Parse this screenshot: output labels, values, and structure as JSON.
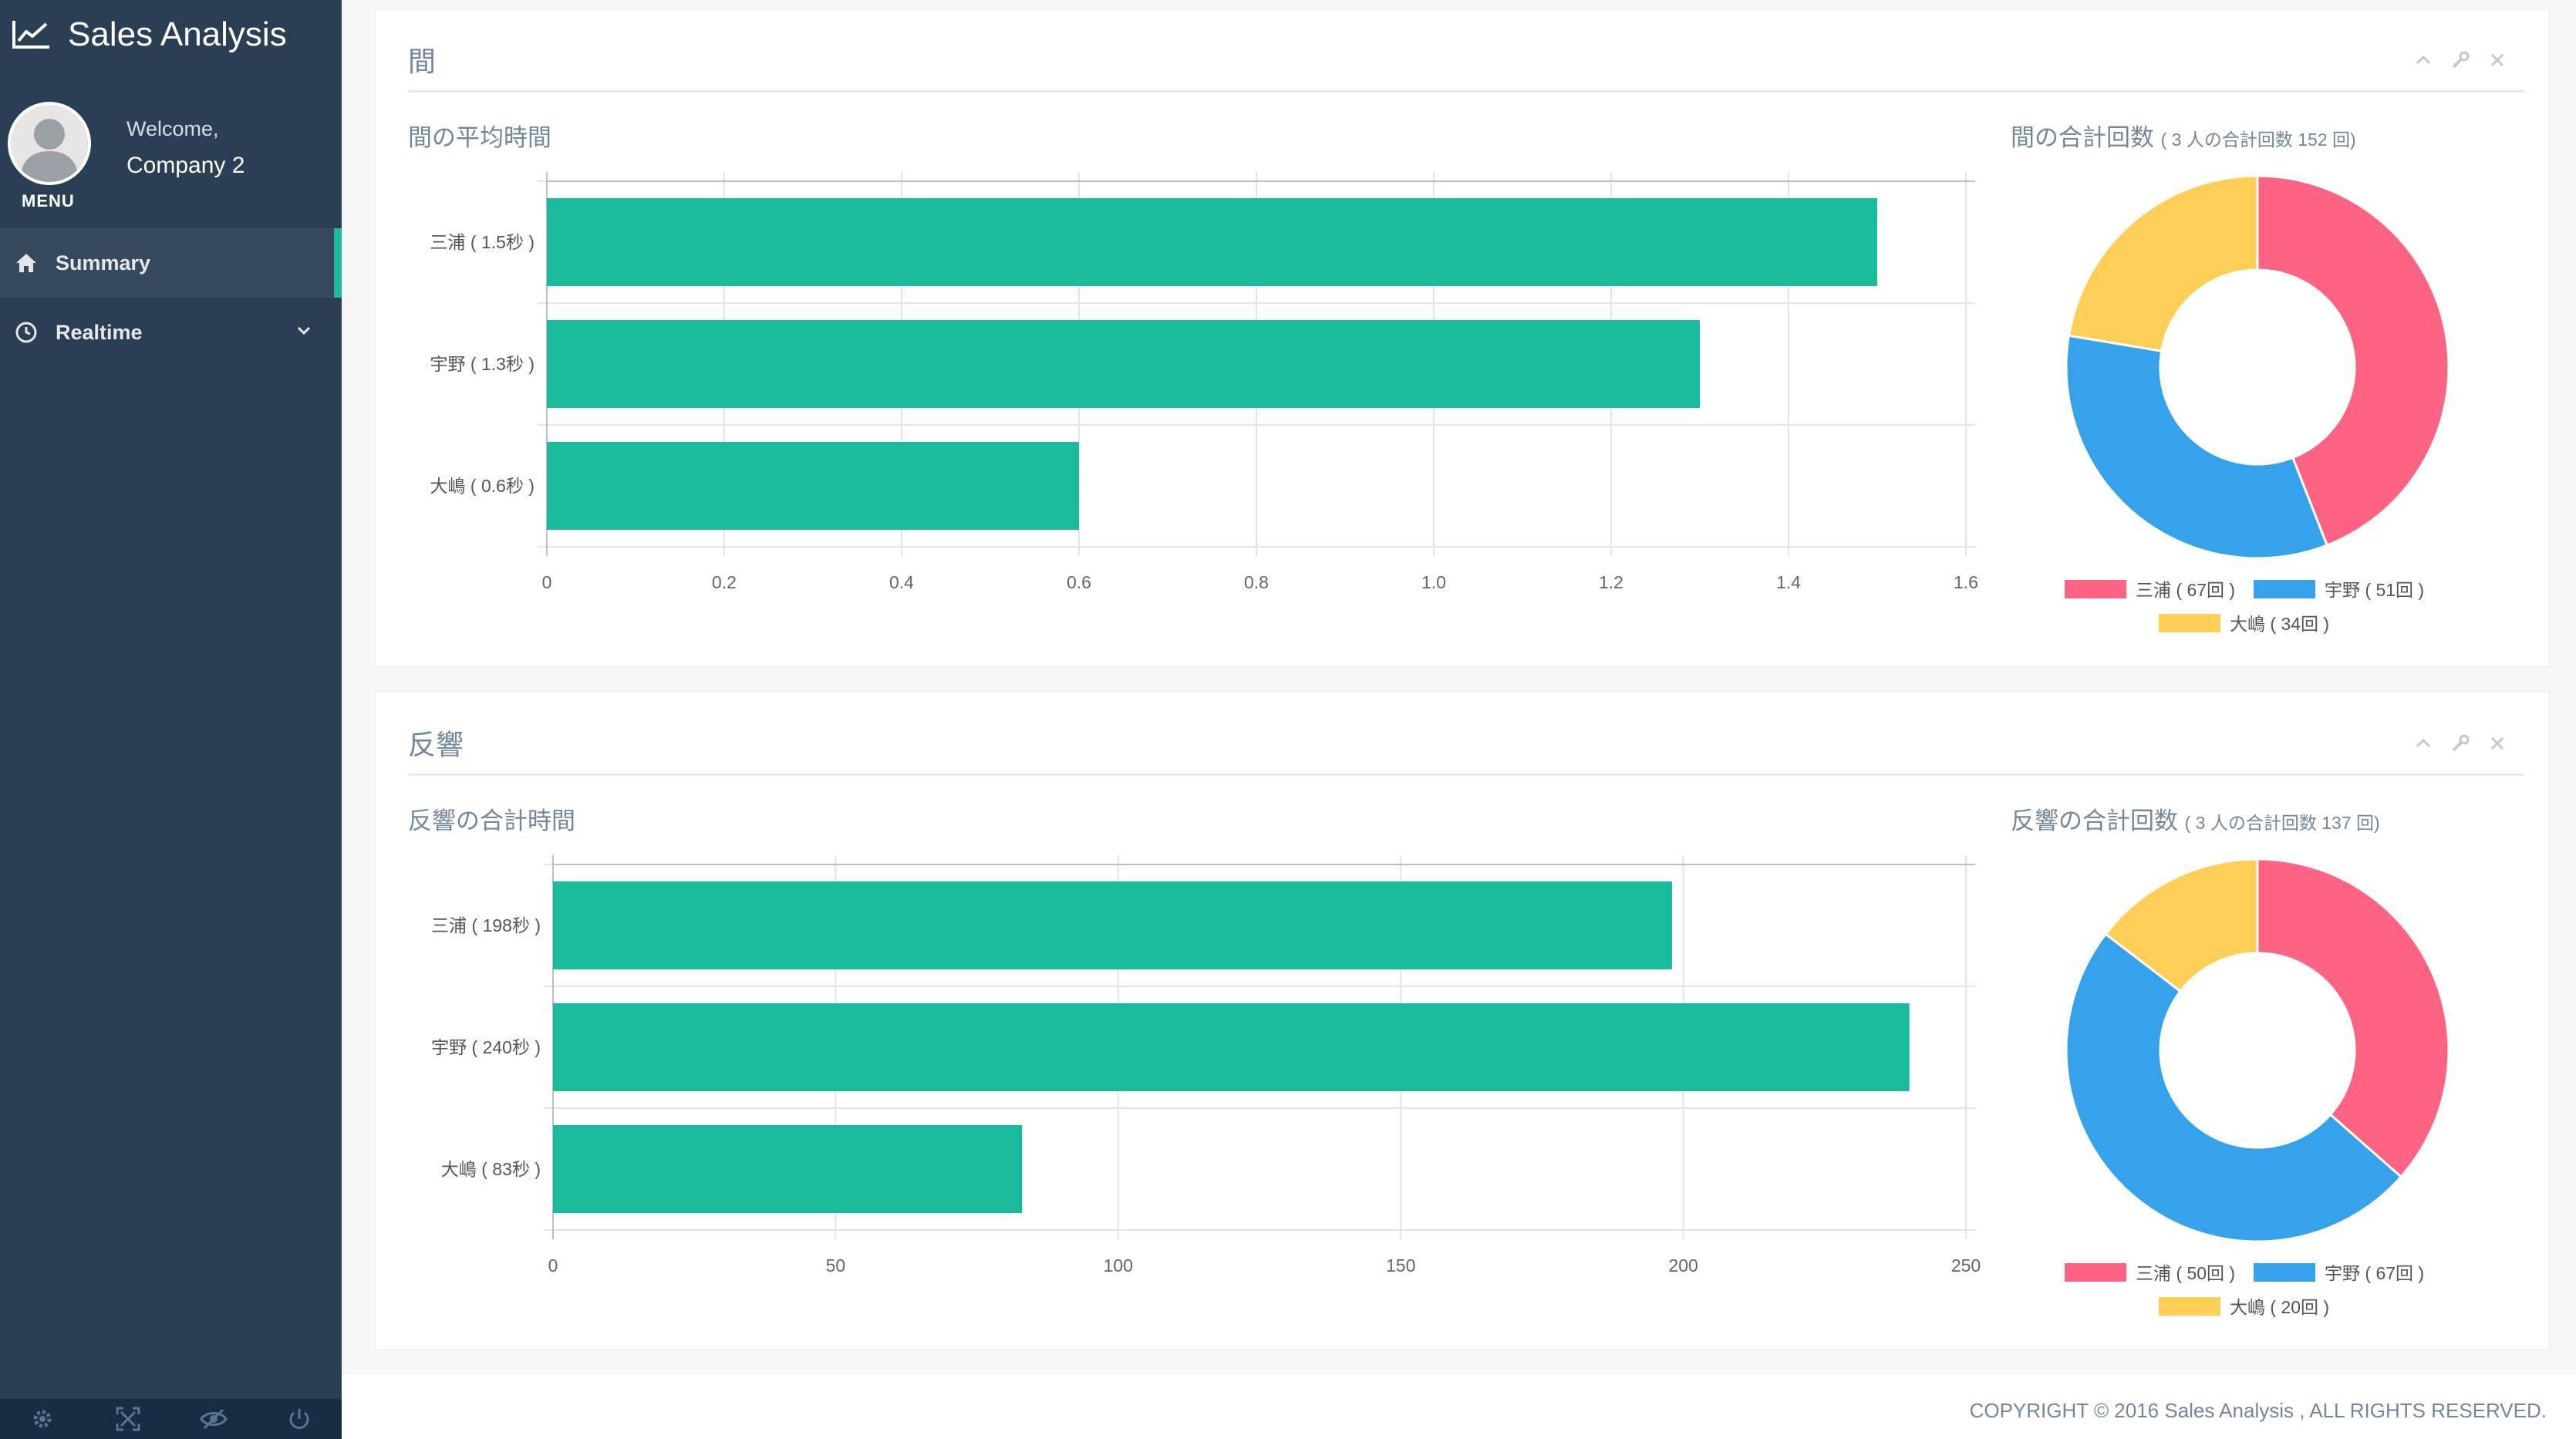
{
  "app": {
    "title": "Sales Analysis",
    "brand_icon": "line-chart-icon"
  },
  "profile": {
    "welcome": "Welcome,",
    "name": "Company 2",
    "menu_label": "MENU"
  },
  "sidebar": {
    "items": [
      {
        "label": "Summary",
        "icon": "home-icon",
        "active": true
      },
      {
        "label": "Realtime",
        "icon": "clock-icon",
        "active": false
      }
    ],
    "footer_icons": [
      "settings-icon",
      "fullscreen-icon",
      "lock-icon",
      "power-icon"
    ]
  },
  "colors": {
    "sidebar_bg": "#2a3f54",
    "accent": "#1abb9c",
    "bar": "#1abb9c",
    "pie_pink": "#ff6384",
    "pie_blue": "#36a2eb",
    "pie_yellow": "#ffce56"
  },
  "panels": [
    {
      "title": "間",
      "bar_title": "間の平均時間",
      "pie_title": "間の合計回数",
      "pie_subtitle": "( 3 人の合計回数 152 回)"
    },
    {
      "title": "反響",
      "bar_title": "反響の合計時間",
      "pie_title": "反響の合計回数",
      "pie_subtitle": "( 3 人の合計回数 137 回)"
    }
  ],
  "chart_data": [
    {
      "type": "bar",
      "orientation": "horizontal",
      "title": "間の平均時間",
      "categories": [
        "三浦 ( 1.5秒 )",
        "宇野 ( 1.3秒 )",
        "大嶋 ( 0.6秒 )"
      ],
      "values": [
        1.5,
        1.3,
        0.6
      ],
      "xlim": [
        0,
        1.6
      ],
      "xticks": [
        "0",
        "0.2",
        "0.4",
        "0.6",
        "0.8",
        "1.0",
        "1.2",
        "1.4",
        "1.6"
      ],
      "tick_values": [
        0,
        0.2,
        0.4,
        0.6,
        0.8,
        1.0,
        1.2,
        1.4,
        1.6
      ],
      "grid": true,
      "color": "#1abb9c"
    },
    {
      "type": "pie",
      "donut": true,
      "title": "間の合計回数",
      "subtitle": "( 3 人の合計回数 152 回)",
      "labels": [
        "三浦 ( 67回 )",
        "宇野 ( 51回 )",
        "大嶋 ( 34回 )"
      ],
      "values": [
        67,
        51,
        34
      ],
      "colors": [
        "#ff6384",
        "#36a2eb",
        "#ffce56"
      ],
      "legend": "bottom"
    },
    {
      "type": "bar",
      "orientation": "horizontal",
      "title": "反響の合計時間",
      "categories": [
        "三浦 ( 198秒 )",
        "宇野 ( 240秒 )",
        "大嶋 ( 83秒 )"
      ],
      "values": [
        198,
        240,
        83
      ],
      "xlim": [
        0,
        250
      ],
      "xticks": [
        "0",
        "50",
        "100",
        "150",
        "200",
        "250"
      ],
      "tick_values": [
        0,
        50,
        100,
        150,
        200,
        250
      ],
      "grid": true,
      "color": "#1abb9c"
    },
    {
      "type": "pie",
      "donut": true,
      "title": "反響の合計回数",
      "subtitle": "( 3 人の合計回数 137 回)",
      "labels": [
        "三浦 ( 50回 )",
        "宇野 ( 67回 )",
        "大嶋 ( 20回 )"
      ],
      "values": [
        50,
        67,
        20
      ],
      "colors": [
        "#ff6384",
        "#36a2eb",
        "#ffce56"
      ],
      "legend": "bottom"
    }
  ],
  "footer": {
    "copyright": "COPYRIGHT © 2016 Sales Analysis , ALL RIGHTS RESERVED."
  }
}
